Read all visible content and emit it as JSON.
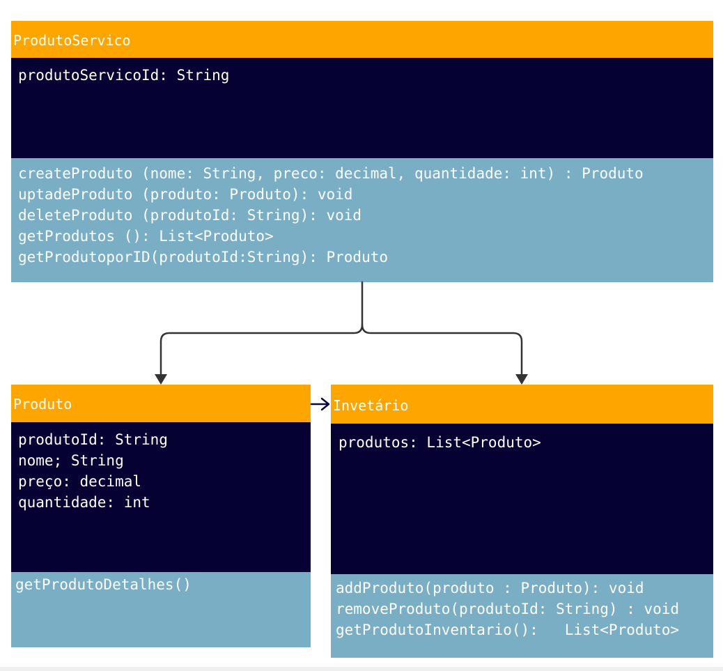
{
  "classes": {
    "servico": {
      "name": "ProdutoServico",
      "attributes": [
        "produtoServicoId: String"
      ],
      "methods": [
        "createProduto (nome: String, preco: decimal, quantidade: int) : Produto",
        "uptadeProduto (produto: Produto): void",
        "deleteProduto (produtoId: String): void",
        "getProdutos (): List<Produto>",
        "getProdutoporID(produtoId:String): Produto"
      ]
    },
    "produto": {
      "name": "Produto",
      "attributes": [
        "produtoId: String",
        "nome; String",
        "preço: decimal",
        "quantidade: int"
      ],
      "methods": [
        "getProdutoDetalhes()"
      ]
    },
    "inventario": {
      "name": "Invetário",
      "attributes": [
        "produtos: List<Produto>"
      ],
      "methods": [
        "addProduto(produto : Produto): void",
        "removeProduto(produtoId: String) : void",
        "getProdutoInventario():   List<Produto>"
      ]
    }
  },
  "colors": {
    "header": "#ffa500",
    "attributes_bg": "#050133",
    "methods_bg": "#7aaec4",
    "connector": "#333333",
    "association_arrow": "#0a0a3c"
  }
}
